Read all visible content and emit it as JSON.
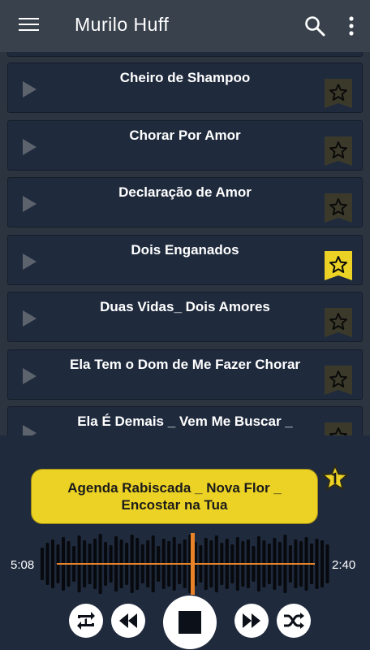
{
  "appbar": {
    "title": "Murilo Huff"
  },
  "songs": [
    {
      "name": "Cheiro de Shampoo",
      "favorite": false
    },
    {
      "name": "Chorar Por Amor",
      "favorite": false
    },
    {
      "name": "Declaração de Amor",
      "favorite": false
    },
    {
      "name": "Dois Enganados",
      "favorite": true
    },
    {
      "name": "Duas Vidas_ Dois Amores",
      "favorite": false
    },
    {
      "name": "Ela Tem o Dom de Me Fazer Chorar",
      "favorite": false
    },
    {
      "name": "Ela É Demais _ Vem Me Buscar _",
      "favorite": false
    }
  ],
  "player": {
    "now_playing": "Agenda Rabiscada _ Nova Flor _ Encostar na Tua",
    "elapsed": "5:08",
    "total": "2:40"
  },
  "colors": {
    "accent": "#ecd224",
    "progress": "#e8832a",
    "card": "#1f2a3d",
    "background": "#2c3440"
  }
}
